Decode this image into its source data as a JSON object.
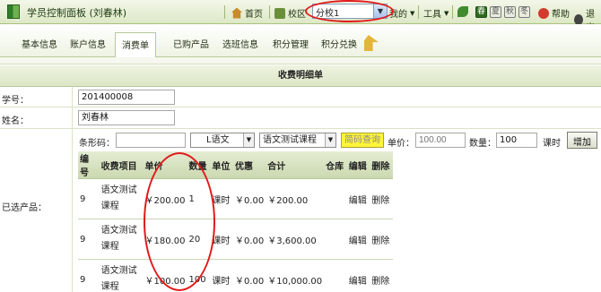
{
  "header": {
    "app_title": "学员控制面板 (刘春林)",
    "home_label": "首页",
    "campus_label": "校区",
    "campus_selected": "分校1",
    "mine_label": "我的",
    "tools_label": "工具",
    "quick_icons": [
      "春",
      "夏",
      "秋",
      "冬"
    ],
    "help_label": "帮助",
    "exit_label": "退出"
  },
  "tabs": [
    {
      "label": "基本信息"
    },
    {
      "label": "账户信息"
    },
    {
      "label": "消费单"
    },
    {
      "label": "已购产品"
    },
    {
      "label": "选班信息"
    },
    {
      "label": "积分管理"
    },
    {
      "label": "积分兑换"
    }
  ],
  "form": {
    "section_title": "收费明细单",
    "student_no_label": "学号：",
    "student_no_value": "201400008",
    "name_label": "姓名：",
    "name_value": "刘春林",
    "barcode_label": "条形码：",
    "barcode_value": "",
    "subject_selected": "L语文",
    "course_selected": "语文测试课程",
    "quick_query_label": "简码查询",
    "unit_price_label": "单价：",
    "unit_price_placeholder": "100.00",
    "quantity_label": "数量：",
    "quantity_value": "100",
    "unit_value": "课时",
    "add_button": "增加",
    "selected_products_label": "已选产品："
  },
  "product_table": {
    "headers": [
      "编号",
      "收费项目",
      "单价",
      "数量",
      "单位",
      "优惠",
      "合计",
      "仓库",
      "编辑",
      "删除"
    ],
    "rows": [
      {
        "id": "9",
        "item_line1": "语文测试",
        "item_line2": "课程",
        "price": "￥200.00",
        "qty": "1",
        "unit": "课时",
        "discount": "￥0.00",
        "total": "￥200.00",
        "warehouse": "",
        "edit": "编辑",
        "delete": "删除"
      },
      {
        "id": "9",
        "item_line1": "语文测试",
        "item_line2": "课程",
        "price": "￥180.00",
        "qty": "20",
        "unit": "课时",
        "discount": "￥0.00",
        "total": "￥3,600.00",
        "warehouse": "",
        "edit": "编辑",
        "delete": "删除"
      },
      {
        "id": "9",
        "item_line1": "语文测试",
        "item_line2": "课程",
        "price": "￥100.00",
        "qty": "100",
        "unit": "课时",
        "discount": "￥0.00",
        "total": "￥10,000.00",
        "warehouse": "",
        "edit": "编辑",
        "delete": "删除"
      }
    ]
  },
  "colors": {
    "header_green": "#dde8c6",
    "annotation_red": "#e11a1a",
    "quick_query_yellow": "#fff43a"
  }
}
